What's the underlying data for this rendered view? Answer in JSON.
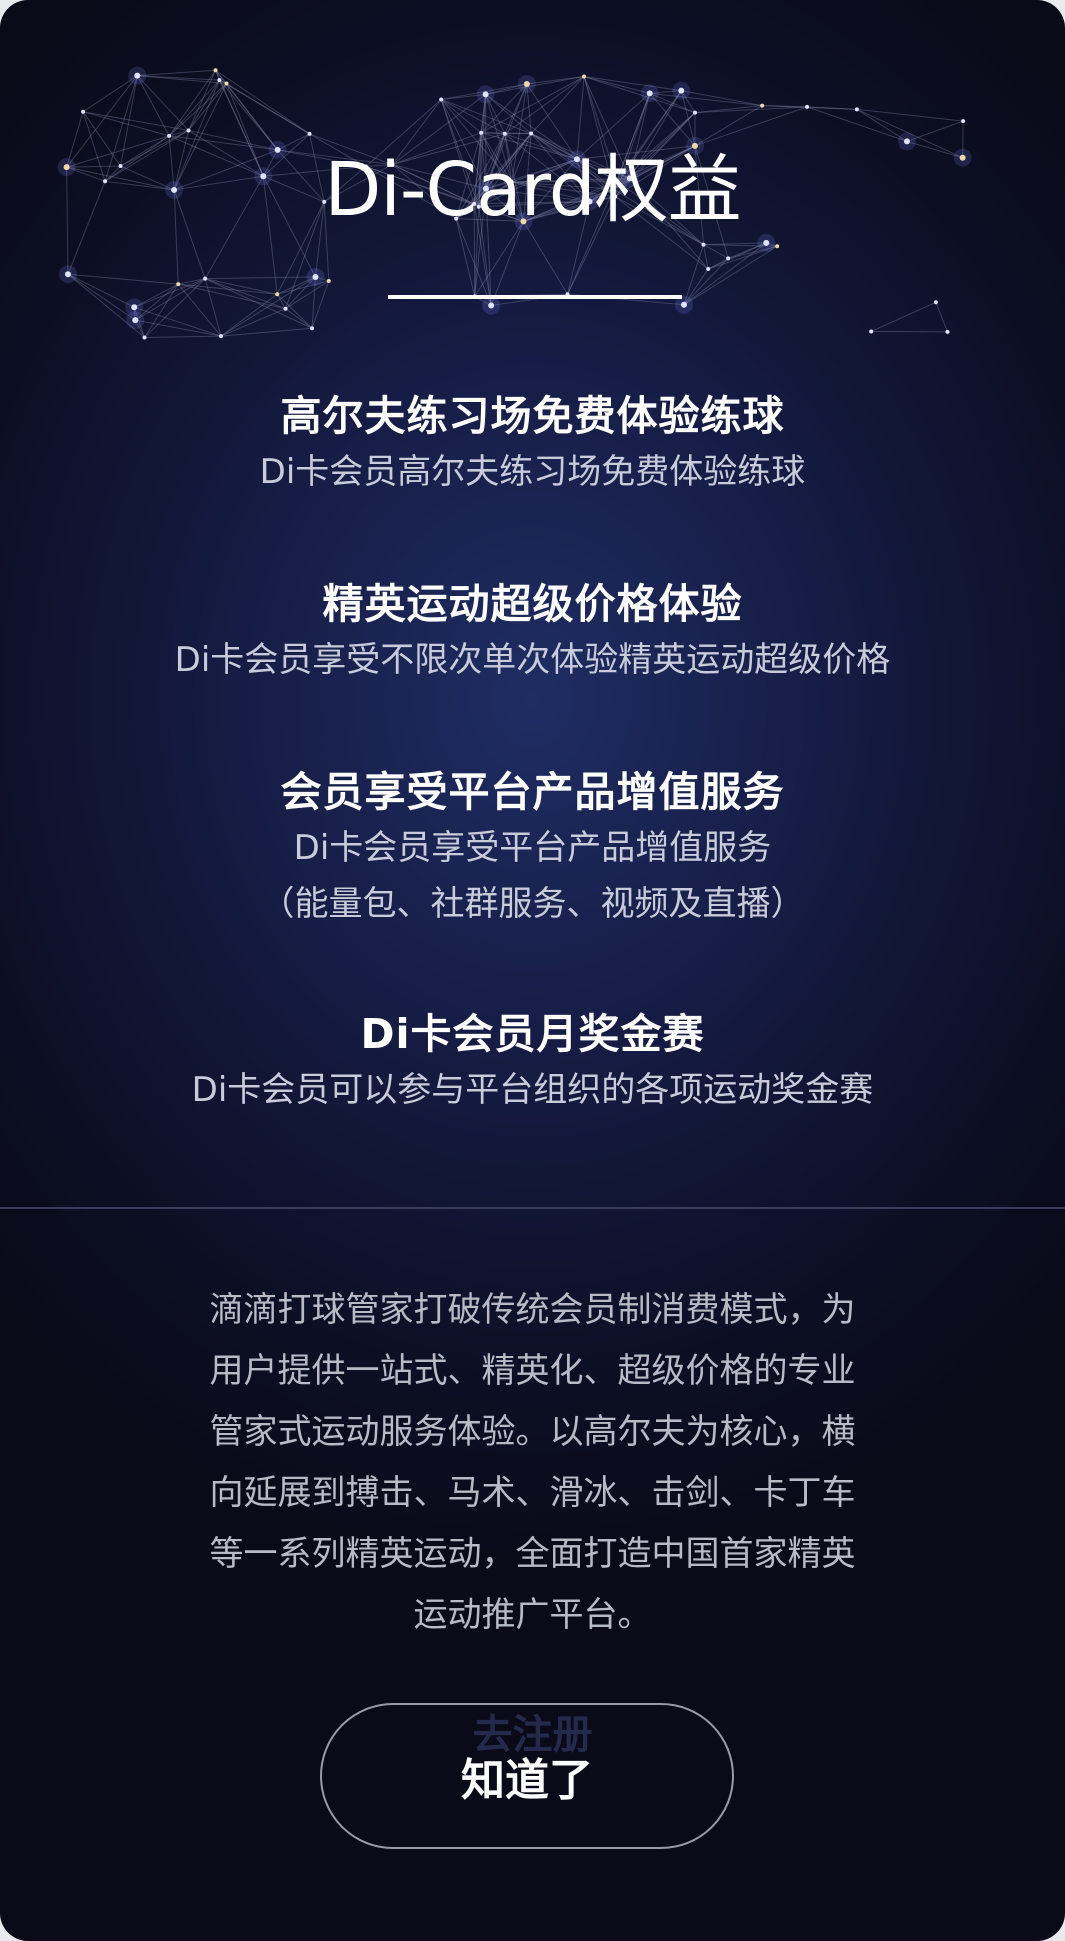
{
  "header": {
    "title": "Di-Card权益"
  },
  "benefits": [
    {
      "title": "高尔夫练习场免费体验练球",
      "desc": "Di卡会员高尔夫练习场免费体验练球"
    },
    {
      "title": "精英运动超级价格体验",
      "desc": "Di卡会员享受不限次单次体验精英运动超级价格"
    },
    {
      "title": "会员享受平台产品增值服务",
      "desc": "Di卡会员享受平台产品增值服务",
      "desc2": "（能量包、社群服务、视频及直播）"
    },
    {
      "title": "Di卡会员月奖金赛",
      "desc": "Di卡会员可以参与平台组织的各项运动奖金赛"
    }
  ],
  "intro": {
    "lines": [
      "滴滴打球管家打破传统会员制消费模式，为",
      "用户提供一站式、精英化、超级价格的专业",
      "管家式运动服务体验。以高尔夫为核心，横",
      "向延展到搏击、马术、滑冰、击剑、卡丁车",
      "等一系列精英运动，全面打造中国首家精英",
      "运动推广平台。"
    ]
  },
  "actions": {
    "ghost_label": "去注册",
    "ok_label": "知道了"
  },
  "colors": {
    "background_center": "#1f2d63",
    "background_edge": "#0a0a18",
    "text_primary": "#ffffff",
    "text_secondary": "#c8cbd9"
  },
  "icons": {
    "decoration": "constellation-network"
  }
}
